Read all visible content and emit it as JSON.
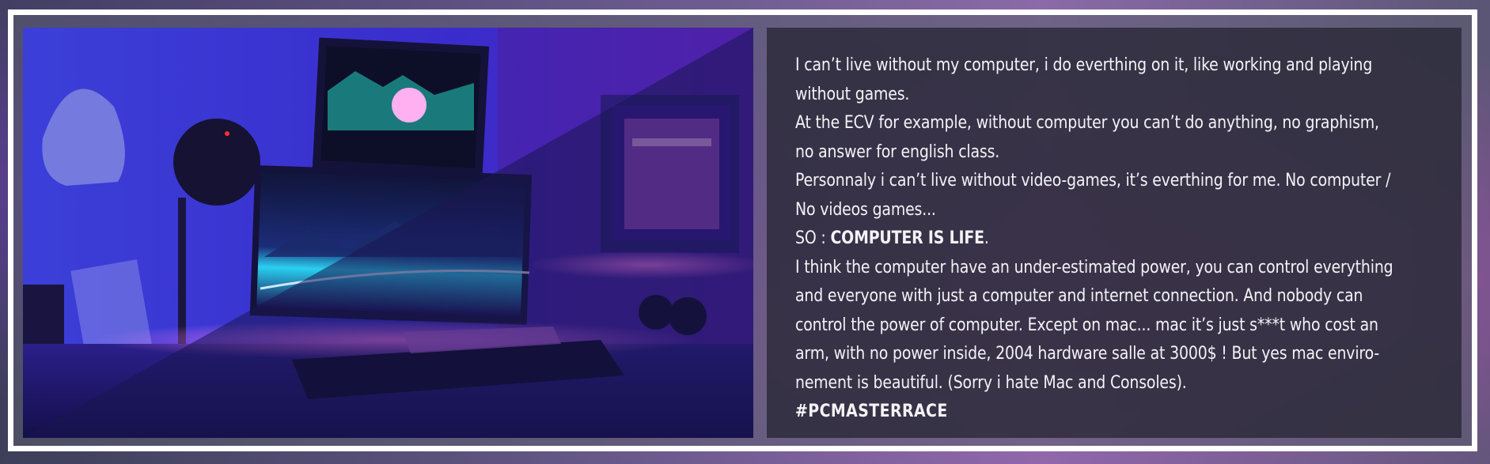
{
  "content": {
    "lines": [
      "I can’t live without my computer,  i do everthing on it, like working and playing",
      "without games.",
      "At the ECV for example, without computer you can’t do anything, no graphism,",
      "no answer for english class.",
      "Personnaly i can’t live without video-games, it’s everthing for me. No computer /",
      "No videos games...",
      "I think the computer have an under-estimated power, you can control everything",
      "and everyone with just a computer and internet connection. And nobody can",
      "control the power of computer. Except on mac... mac it’s just s***t who cost an",
      "arm, with no power inside, 2004 hardware salle at 3000$ ! But yes mac enviro-",
      "nement is beautiful. (Sorry i hate Mac and Consoles)."
    ],
    "so_prefix": "SO : ",
    "so_emphasis": "COMPUTER IS LIFE",
    "so_suffix": ".",
    "hashtag": "#PCMASTERRACE"
  },
  "colors": {
    "frame": "#ffffff",
    "text": "#f3f3f6",
    "panel": "#28263a",
    "photo_blue": "#3a2bd0",
    "photo_pink": "#d44be0"
  },
  "photo": {
    "icon": "gaming-desk-setup-photo"
  }
}
